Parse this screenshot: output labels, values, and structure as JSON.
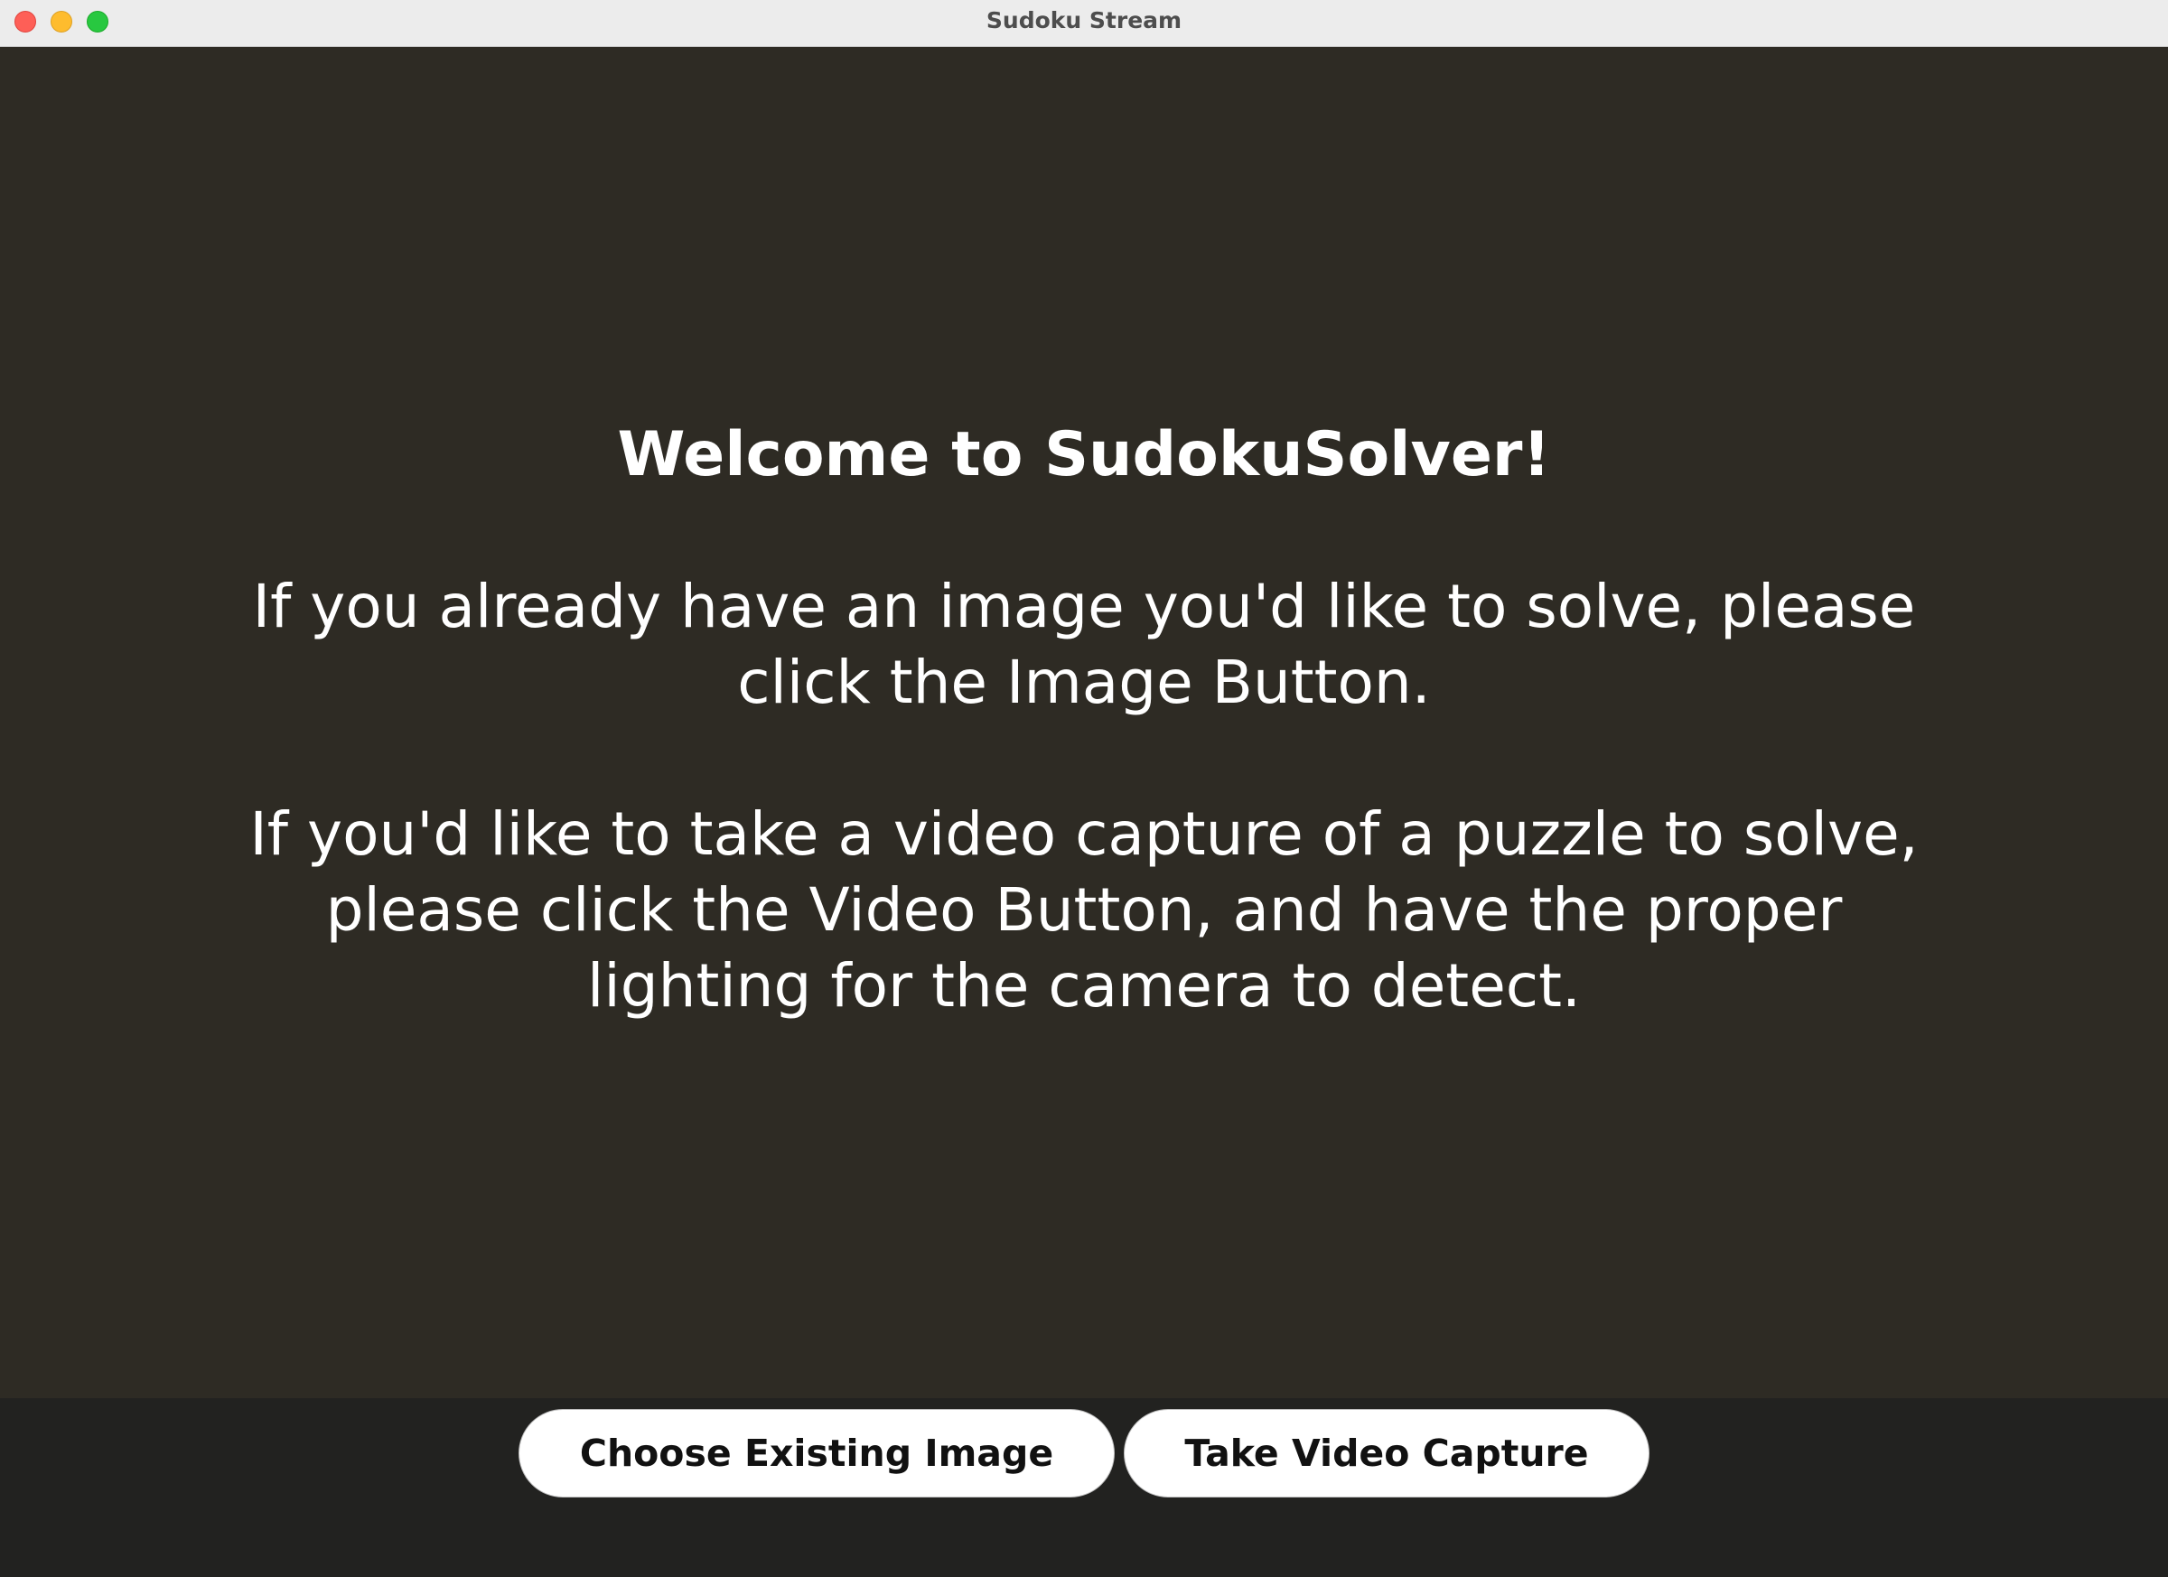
{
  "window": {
    "title": "Sudoku Stream"
  },
  "welcome": {
    "heading": "Welcome to SudokuSolver!",
    "image_instructions": "If you already have an image you'd like to solve, please click the Image Button.",
    "video_instructions": "If you'd like to take a video capture of a puzzle to solve, please click the Video Button, and have the proper lighting for the camera to detect."
  },
  "actions": {
    "image_button_label": "Choose Existing Image",
    "video_button_label": "Take Video Capture"
  },
  "colors": {
    "content_background": "#2e2b24",
    "bottom_bar_background": "#222220",
    "text": "#ffffff",
    "button_background": "#ffffff"
  }
}
